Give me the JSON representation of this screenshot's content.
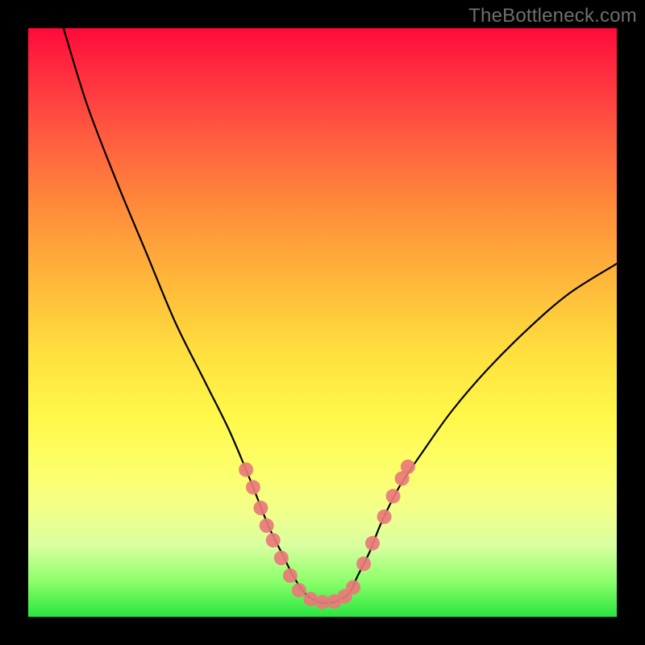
{
  "watermark": "TheBottleneck.com",
  "chart_data": {
    "type": "line",
    "title": "",
    "xlabel": "",
    "ylabel": "",
    "xlim": [
      0,
      100
    ],
    "ylim": [
      0,
      100
    ],
    "notes": "V-shaped bottleneck curve over a red→green vertical gradient. No axes, ticks, legend, or numeric labels are rendered. Values are estimated from pixel positions; y is percent height from bottom.",
    "series": [
      {
        "name": "curve",
        "x": [
          6,
          10,
          15,
          20,
          25,
          30,
          34,
          37,
          39,
          41,
          43,
          45,
          47,
          49.5,
          52,
          54.5,
          56,
          58,
          60,
          63,
          67,
          72,
          78,
          85,
          92,
          100
        ],
        "y": [
          100,
          87,
          74,
          62,
          50,
          40,
          32,
          25,
          20,
          15,
          11,
          7,
          4,
          2.5,
          2.5,
          4,
          7,
          11,
          16,
          22,
          28,
          35,
          42,
          49,
          55,
          60
        ]
      }
    ],
    "markers": [
      {
        "name": "left-dot-1",
        "x": 37.0,
        "y": 25.0
      },
      {
        "name": "left-dot-2",
        "x": 38.2,
        "y": 22.0
      },
      {
        "name": "left-dot-3",
        "x": 39.5,
        "y": 18.5
      },
      {
        "name": "left-dot-4",
        "x": 40.5,
        "y": 15.5
      },
      {
        "name": "left-dot-5",
        "x": 41.6,
        "y": 13.0
      },
      {
        "name": "left-dot-6",
        "x": 43.0,
        "y": 10.0
      },
      {
        "name": "left-dot-7",
        "x": 44.5,
        "y": 7.0
      },
      {
        "name": "bottom-dot-1",
        "x": 46.0,
        "y": 4.5
      },
      {
        "name": "bottom-dot-2",
        "x": 48.0,
        "y": 3.0
      },
      {
        "name": "bottom-dot-3",
        "x": 50.0,
        "y": 2.5
      },
      {
        "name": "bottom-dot-4",
        "x": 52.0,
        "y": 2.6
      },
      {
        "name": "bottom-dot-5",
        "x": 53.8,
        "y": 3.5
      },
      {
        "name": "bottom-dot-6",
        "x": 55.2,
        "y": 5.0
      },
      {
        "name": "right-dot-1",
        "x": 57.0,
        "y": 9.0
      },
      {
        "name": "right-dot-2",
        "x": 58.5,
        "y": 12.5
      },
      {
        "name": "right-dot-3",
        "x": 60.5,
        "y": 17.0
      },
      {
        "name": "right-dot-4",
        "x": 62.0,
        "y": 20.5
      },
      {
        "name": "right-dot-5",
        "x": 63.5,
        "y": 23.5
      },
      {
        "name": "right-dot-6",
        "x": 64.5,
        "y": 25.5
      }
    ],
    "colors": {
      "curve_stroke": "#000000",
      "marker_fill": "#e97a7a",
      "gradient_top": "#ff0a3a",
      "gradient_bottom": "#28e640"
    }
  }
}
